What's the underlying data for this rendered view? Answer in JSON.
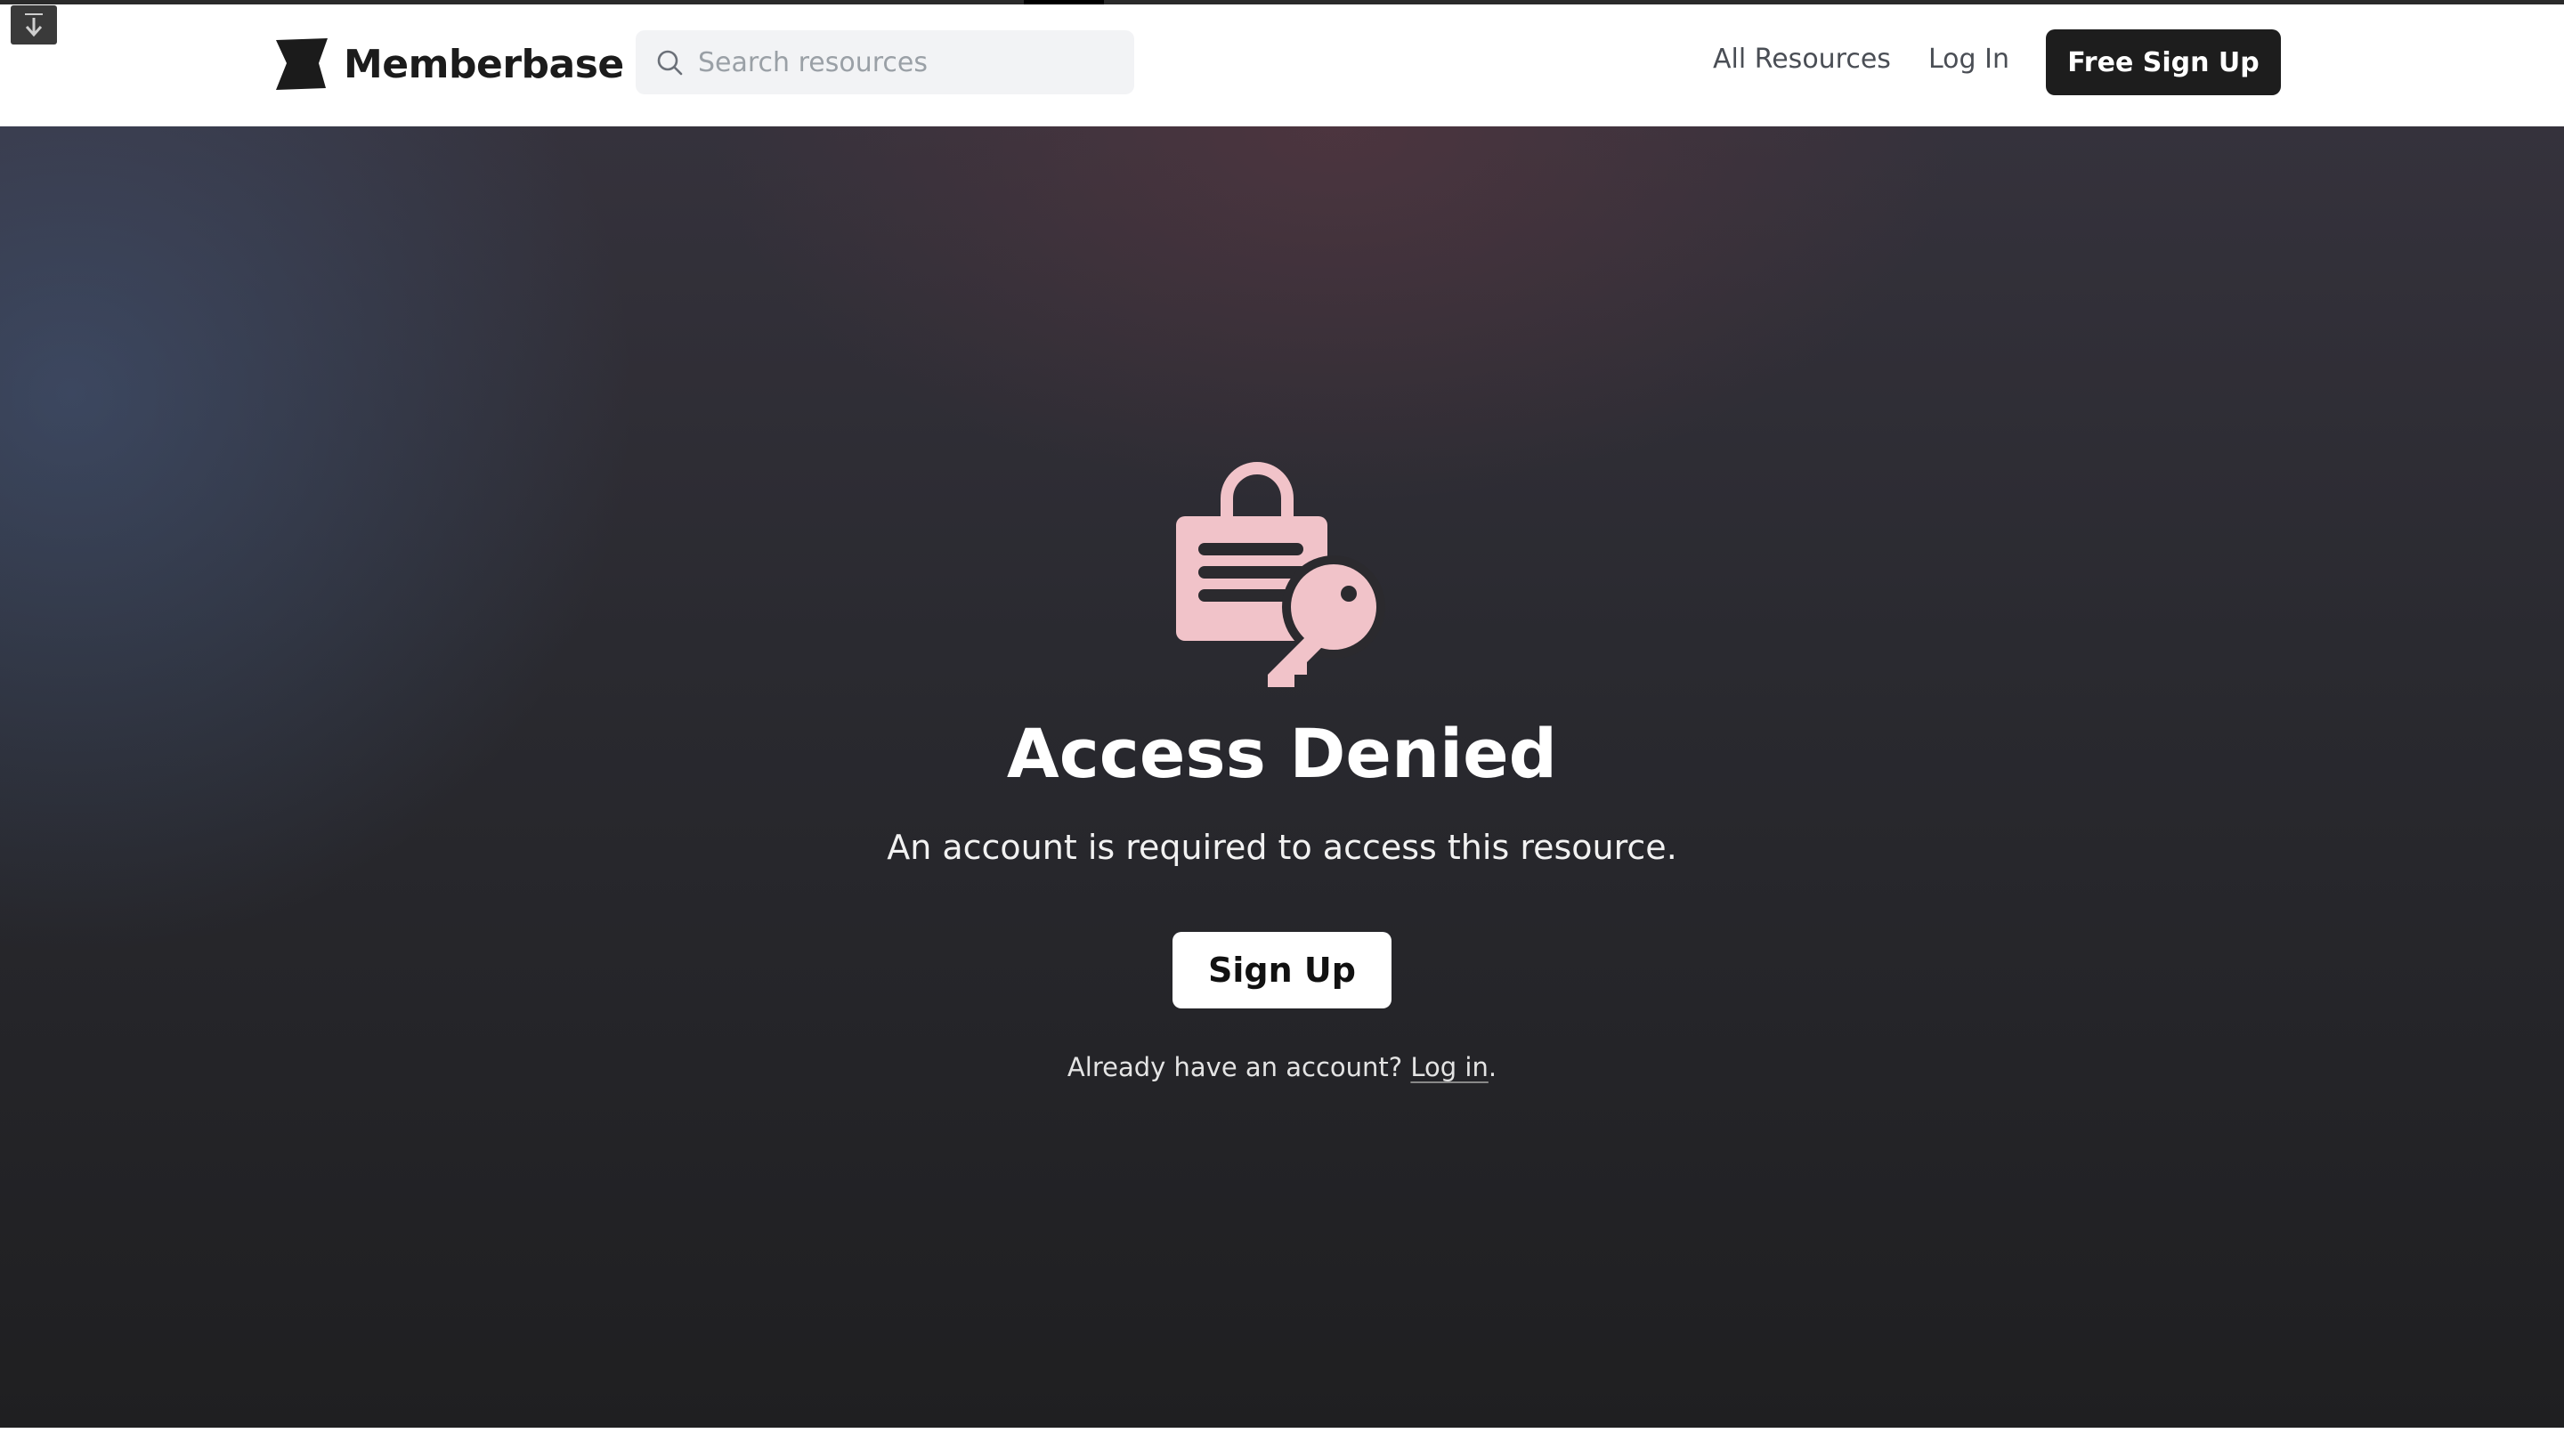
{
  "header": {
    "brand_name": "Memberbase",
    "logo_icon": "memberbase-logo-icon",
    "search": {
      "placeholder": "Search resources",
      "icon": "search-icon"
    },
    "nav": {
      "all_resources": "All Resources",
      "log_in": "Log In",
      "free_sign_up": "Free Sign Up"
    }
  },
  "main": {
    "illustration_icon": "lock-key-icon",
    "title": "Access Denied",
    "subtitle": "An account is required to access this resource.",
    "sign_up_label": "Sign Up",
    "login_prompt": {
      "prefix": "Already have an account?",
      "link": "Log in",
      "suffix": "."
    }
  },
  "colors": {
    "primary_button": "#1d1d1d",
    "illustration": "#f1c3c9",
    "hero_dark": "#1f1f21"
  }
}
